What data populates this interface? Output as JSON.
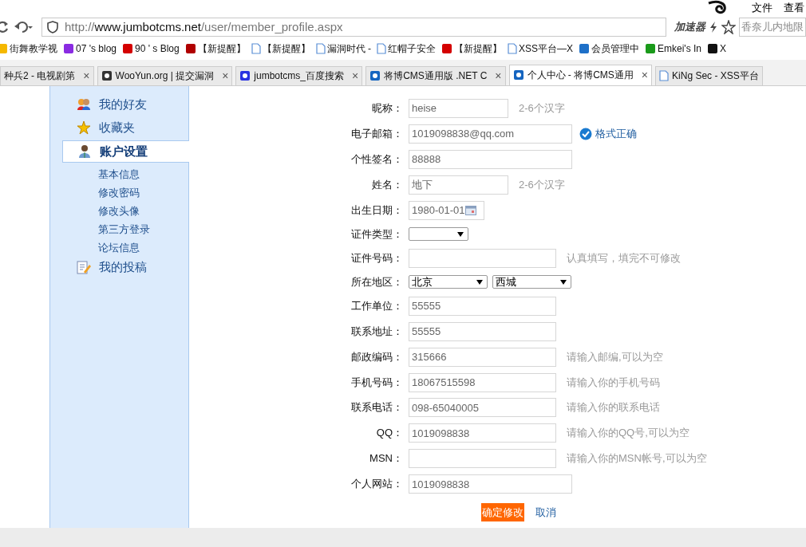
{
  "menu": [
    "文件",
    "查看"
  ],
  "address_bar": {
    "scheme": "http://",
    "host": "www.jumbotcms.net",
    "path": "/user/member_profile.aspx",
    "accelerator": "加速器"
  },
  "search": {
    "placeholder": "香奈儿内地限"
  },
  "bookmarks": [
    {
      "label": "街舞教学视",
      "kind": "favicon",
      "color": "#f5b800"
    },
    {
      "label": "07 's blog",
      "kind": "favicon",
      "color": "#8a2be2"
    },
    {
      "label": "90 ' s Blog",
      "kind": "favicon",
      "color": "#d40000"
    },
    {
      "label": "【新提醒】",
      "kind": "favicon",
      "color": "#b00000"
    },
    {
      "label": "【新提醒】",
      "kind": "page"
    },
    {
      "label": "漏洞时代 -",
      "kind": "page"
    },
    {
      "label": "红帽子安全",
      "kind": "page"
    },
    {
      "label": "【新提醒】",
      "kind": "favicon",
      "color": "#d40000"
    },
    {
      "label": "XSS平台—X",
      "kind": "page"
    },
    {
      "label": "会员管理中",
      "kind": "favicon",
      "color": "#1e70c8"
    },
    {
      "label": "Emkei's In",
      "kind": "favicon",
      "color": "#1a9a1a"
    },
    {
      "label": "X",
      "kind": "favicon",
      "color": "#111111"
    }
  ],
  "tabs": [
    {
      "title": "种兵2 - 电视剧第",
      "close": "×",
      "selected": false
    },
    {
      "title": "WooYun.org | 提交漏洞",
      "close": "×",
      "selected": false,
      "color": "#333333"
    },
    {
      "title": "jumbotcms_百度搜索",
      "close": "×",
      "selected": false,
      "color": "#2932e1"
    },
    {
      "title": "将博CMS通用版 .NET C",
      "close": "×",
      "selected": false,
      "color": "#1565c0"
    },
    {
      "title": "个人中心 - 将博CMS通用",
      "close": "×",
      "selected": true,
      "color": "#1565c0"
    },
    {
      "title": "KiNg Sec - XSS平台",
      "selected": false
    }
  ],
  "sidebar": {
    "items": [
      {
        "label": "我的好友",
        "kind": "friends",
        "selected": false
      },
      {
        "label": "收藏夹",
        "kind": "star",
        "selected": false
      },
      {
        "label": "账户设置",
        "kind": "account",
        "selected": true,
        "children": [
          {
            "label": "基本信息"
          },
          {
            "label": "修改密码"
          },
          {
            "label": "修改头像"
          },
          {
            "label": "第三方登录"
          },
          {
            "label": "论坛信息"
          }
        ]
      },
      {
        "label": "我的投稿",
        "kind": "edit",
        "selected": false
      }
    ]
  },
  "form": {
    "rows": [
      {
        "kind": "text",
        "label": "昵称：",
        "value": "heise",
        "hint": "2-6个汉字"
      },
      {
        "kind": "text",
        "label": "电子邮箱：",
        "value": "1019098838@qq.com",
        "status": "格式正确"
      },
      {
        "kind": "text",
        "label": "个性签名：",
        "value": "88888"
      },
      {
        "kind": "text",
        "label": "姓名：",
        "value": "地下",
        "hint": "2-6个汉字"
      },
      {
        "kind": "date",
        "label": "出生日期：",
        "value": "1980-01-01"
      },
      {
        "kind": "select",
        "label": "证件类型："
      },
      {
        "kind": "text",
        "label": "证件号码：",
        "hint": "认真填写，填完不可修改"
      },
      {
        "kind": "select",
        "label": "所在地区：",
        "options": [
          {
            "value": "北京"
          },
          {
            "value": "西城"
          }
        ]
      },
      {
        "kind": "text",
        "label": "工作单位：",
        "value": "55555"
      },
      {
        "kind": "text",
        "label": "联系地址：",
        "value": "55555"
      },
      {
        "kind": "text",
        "label": "邮政编码：",
        "value": "315666",
        "hint": "请输入邮编,可以为空"
      },
      {
        "kind": "text",
        "label": "手机号码：",
        "value": "18067515598",
        "hint": "请输入你的手机号码"
      },
      {
        "kind": "text",
        "label": "联系电话：",
        "value": "098-65040005",
        "hint": "请输入你的联系电话"
      },
      {
        "kind": "text",
        "label": "QQ：",
        "value": "1019098838",
        "hint": "请输入你的QQ号,可以为空"
      },
      {
        "kind": "text",
        "label": "MSN：",
        "hint": "请输入你的MSN帐号,可以为空"
      },
      {
        "kind": "text",
        "label": "个人网站：",
        "value": "1019098838"
      }
    ],
    "submit": "确定修改",
    "cancel": "取消"
  }
}
